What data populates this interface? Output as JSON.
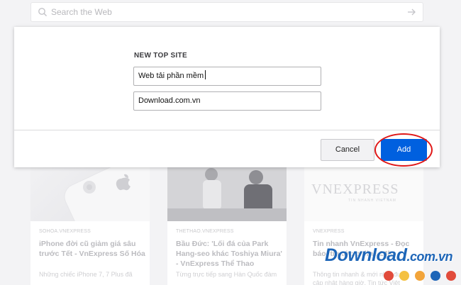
{
  "search": {
    "placeholder": "Search the Web"
  },
  "cards": [
    {
      "source": "SOHOA.VNEXPRESS",
      "title": "iPhone đời cũ giảm giá sâu trước Tết - VnExpress Số Hóa",
      "desc": "Những chiếc iPhone 7, 7 Plus đã"
    },
    {
      "source": "THETHAO.VNEXPRESS",
      "title": "Bầu Đức: 'Lối đá của Park Hang-seo khác Toshiya Miura' - VnExpress Thể Thao",
      "desc": "Từng trực tiếp sang Hàn Quốc đàm"
    },
    {
      "source": "VNEXPRESS",
      "title": "Tin nhanh VnExpress - Đọc báo, tin tức online 24h",
      "desc": "Thông tin nhanh & mới nhất được cập nhật hàng giờ. Tin tức Việt"
    }
  ],
  "vnexpress_logo": {
    "main": "VNEXPRESS",
    "sub": "TIN NHANH VIETNAM"
  },
  "modal": {
    "title": "NEW TOP SITE",
    "title_field_value": "Web tải phần mềm",
    "url_field_value": "Download.com.vn",
    "cancel_label": "Cancel",
    "add_label": "Add"
  },
  "watermark": {
    "text": "Download",
    "suffix": ".com.vn"
  },
  "colors": {
    "accent_blue": "#0060df",
    "highlight_red": "#e01818",
    "dots": [
      "#e14b3b",
      "#f4c142",
      "#f2a43a",
      "#1e66b8",
      "#e14b3b"
    ]
  }
}
